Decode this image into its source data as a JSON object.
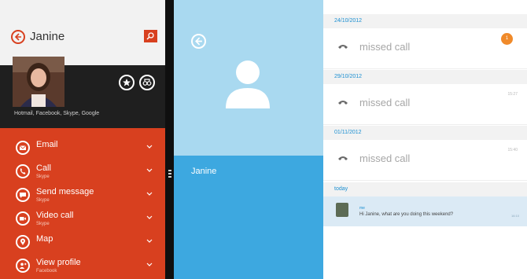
{
  "people": {
    "contact_name": "Janine",
    "accounts": "Hotmail, Facebook, Skype, Google",
    "actions": [
      {
        "label": "Email",
        "sub": ""
      },
      {
        "label": "Call",
        "sub": "Skype"
      },
      {
        "label": "Send message",
        "sub": "Skype"
      },
      {
        "label": "Video call",
        "sub": "Skype"
      },
      {
        "label": "Map",
        "sub": ""
      },
      {
        "label": "View profile",
        "sub": "Facebook"
      }
    ]
  },
  "skype": {
    "contact_name": "Janine"
  },
  "conversation": {
    "entries": [
      {
        "date": "24/10/2012",
        "text": "missed call",
        "time": ""
      },
      {
        "date": "29/10/2012",
        "text": "missed call",
        "time": "15:27"
      },
      {
        "date": "01/11/2012",
        "text": "missed call",
        "time": "15:40"
      }
    ],
    "badge": "1",
    "today_label": "today",
    "message": {
      "sender": "me",
      "text": "Hi Janine, what are you doing this weekend?",
      "time": "16:10"
    }
  },
  "colors": {
    "accent": "#d8401f",
    "skype_blue": "#3da8e0",
    "skype_light": "#a9d9f0",
    "link_blue": "#1b8fd1"
  }
}
